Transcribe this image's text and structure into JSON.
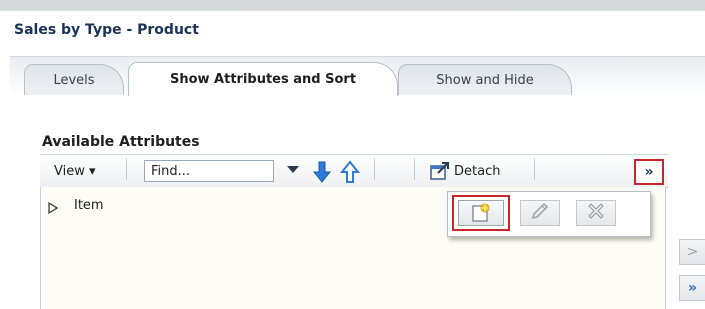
{
  "page": {
    "title": "Sales by Type - Product"
  },
  "tabs": [
    {
      "label": "Levels",
      "active": false
    },
    {
      "label": "Show Attributes and Sort",
      "active": true
    },
    {
      "label": "Show and Hide",
      "active": false
    }
  ],
  "section": {
    "title": "Available Attributes"
  },
  "toolbar": {
    "view_label": "View ▾",
    "find_placeholder": "Find...",
    "detach_label": "Detach",
    "overflow_label": "»"
  },
  "list": {
    "items": [
      {
        "label": "Item",
        "expanded": false
      }
    ]
  },
  "popup": {
    "buttons": [
      "new-icon",
      "edit-pencil-icon",
      "delete-x-icon"
    ]
  },
  "shuttle": {
    "move_label": ">",
    "move_all_label": "»"
  },
  "colors": {
    "highlight": "#c6262c",
    "title_text": "#1a3356",
    "arrow_blue": "#2f7ad6",
    "list_bg": "#fdfdf5"
  }
}
